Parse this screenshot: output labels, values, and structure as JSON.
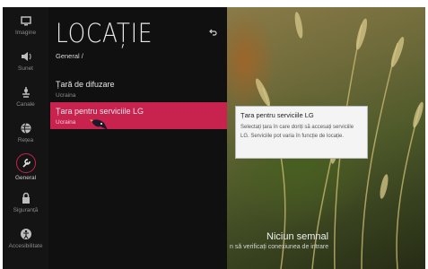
{
  "sidebar": {
    "items": [
      {
        "label": "Imagine",
        "icon": "picture-icon"
      },
      {
        "label": "Sunet",
        "icon": "speaker-icon"
      },
      {
        "label": "Canale",
        "icon": "antenna-icon"
      },
      {
        "label": "Rețea",
        "icon": "globe-icon"
      },
      {
        "label": "General",
        "icon": "wrench-icon",
        "active": true
      },
      {
        "label": "Siguranță",
        "icon": "lock-icon"
      },
      {
        "label": "Accesibilitate",
        "icon": "accessibility-icon"
      }
    ]
  },
  "panel": {
    "title": "LOCAȚIE",
    "breadcrumb": "General /",
    "options": [
      {
        "label": "Țară de difuzare",
        "value": "Ucraina"
      },
      {
        "label": "Țara pentru serviciile LG",
        "value": "Ucraina",
        "selected": true
      }
    ]
  },
  "tooltip": {
    "title": "Țara pentru serviciile LG",
    "body": "Selectați țara în care doriți să accesați serviciile LG. Serviciile pot varia în funcție de locație."
  },
  "status": {
    "title": "Niciun semnal",
    "subtitle": "n să verificați conexiunea de intrare"
  },
  "colors": {
    "accent": "#c8224e",
    "panel": "#101010",
    "sidebar": "#141414"
  }
}
